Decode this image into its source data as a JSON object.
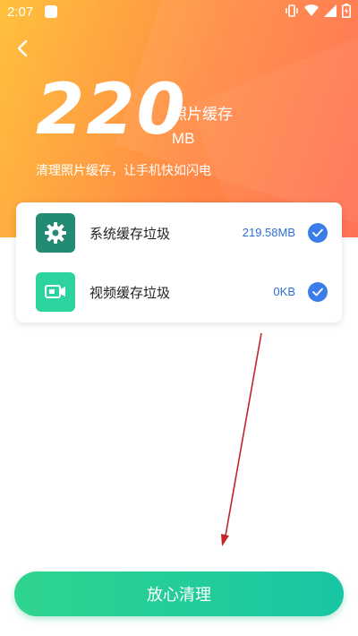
{
  "status_bar": {
    "time": "2:07"
  },
  "hero": {
    "size_number": "220",
    "unit_label": "照片缓存",
    "unit": "MB",
    "subtitle": "清理照片缓存，让手机快如闪电",
    "colors": {
      "gradient_start": "#ffc13d",
      "gradient_end": "#ff6a4d"
    }
  },
  "items": [
    {
      "label": "系统缓存垃圾",
      "size": "219.58MB",
      "icon": "gear-icon",
      "icon_color": "#238a73",
      "checked": true
    },
    {
      "label": "视频缓存垃圾",
      "size": "0KB",
      "icon": "video-icon",
      "icon_color": "#2cd39f",
      "checked": true
    }
  ],
  "clean_button": {
    "label": "放心清理",
    "color": "#2fd48e"
  },
  "annotation": {
    "arrow_color": "#c0262a"
  }
}
